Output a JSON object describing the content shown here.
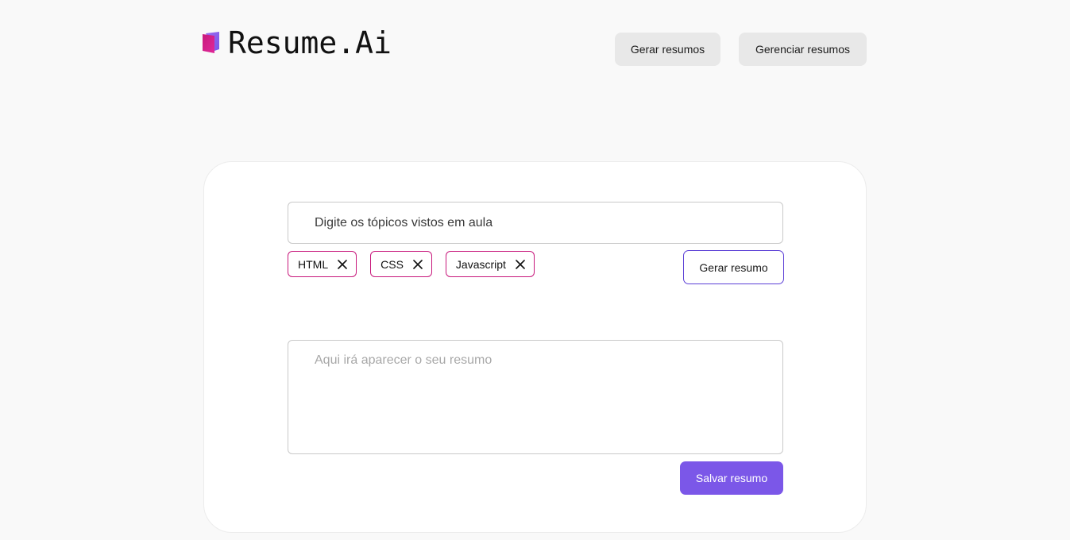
{
  "header": {
    "logo_text": "Resume.Ai",
    "logo_icon": "book-icon",
    "nav": [
      {
        "label": "Gerar resumos"
      },
      {
        "label": "Gerenciar resumos"
      }
    ]
  },
  "form": {
    "topic_input": {
      "placeholder": "Digite os tópicos vistos em aula",
      "value": ""
    },
    "tags": [
      {
        "label": "HTML"
      },
      {
        "label": "CSS"
      },
      {
        "label": "Javascript"
      }
    ],
    "generate_label": "Gerar resumo",
    "summary": {
      "placeholder": "Aqui irá aparecer o seu resumo",
      "value": ""
    },
    "save_label": "Salvar resumo"
  },
  "colors": {
    "accent": "#7b57e8",
    "tag_border": "#c8197c",
    "logo_gradient": [
      "#c8197c",
      "#7b57e8"
    ]
  }
}
